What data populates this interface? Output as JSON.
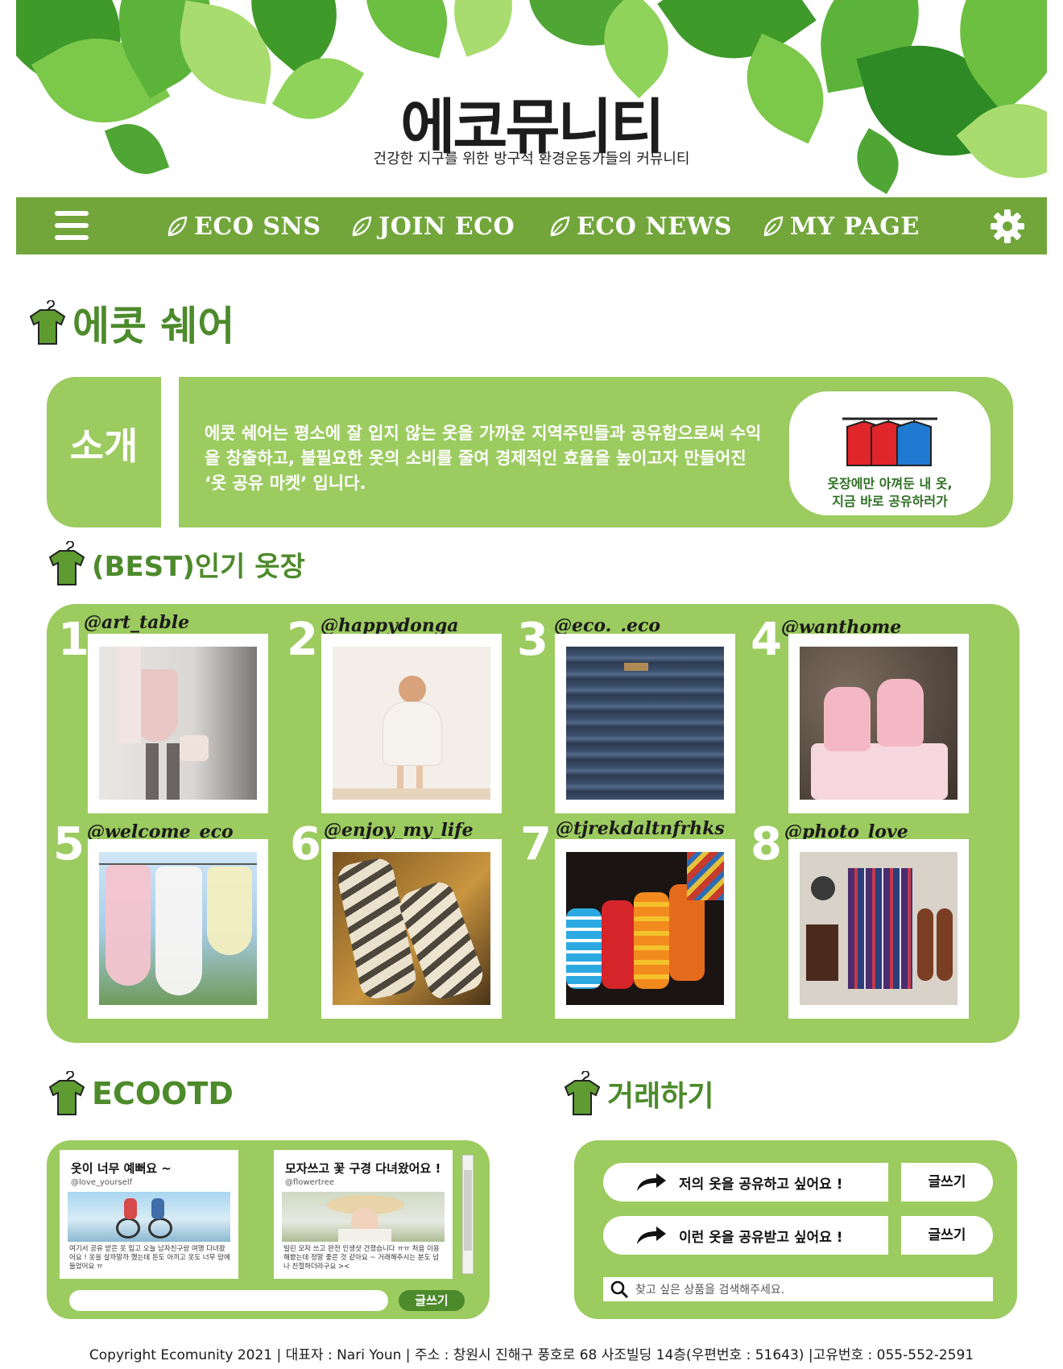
{
  "header": {
    "title": "에코뮤니티",
    "subtitle": "건강한 지구를 위한 방구석 환경운동가들의 커뮤니티"
  },
  "nav": {
    "items": [
      {
        "label": "ECO SNS"
      },
      {
        "label": "JOIN ECO"
      },
      {
        "label": "ECO NEWS"
      },
      {
        "label": "MY PAGE"
      }
    ]
  },
  "page_title": "에콧 쉐어",
  "intro": {
    "label": "소개",
    "text": "에콧 쉐어는 평소에 잘 입지 않는 옷을 가까운 지역주민들과 공유함으로써 수익을 창출하고, 불필요한 옷의 소비를 줄여 경제적인 효율을 높이고자 만들어진 ‘옷 공유 마켓’ 입니다.",
    "card_line1": "옷장에만 아껴둔 내 옷,",
    "card_line2": "지금 바로 공유하러가"
  },
  "best": {
    "heading": "(BEST)인기 옷장",
    "items": [
      {
        "rank": "1",
        "user": "@art_table"
      },
      {
        "rank": "2",
        "user": "@happydonga"
      },
      {
        "rank": "3",
        "user": "@eco._.eco"
      },
      {
        "rank": "4",
        "user": "@wanthome"
      },
      {
        "rank": "5",
        "user": "@welcome_eco"
      },
      {
        "rank": "6",
        "user": "@enjoy_my_life"
      },
      {
        "rank": "7",
        "user": "@tjrekdaltnfrhks"
      },
      {
        "rank": "8",
        "user": "@photo_love"
      }
    ]
  },
  "ootd": {
    "heading": "ECOOTD",
    "posts": [
      {
        "title": "옷이 너무 예뻐요 ~",
        "user": "@love_yourself",
        "body": "여기서 공유 받은 옷 입고 오늘 남자친구랑 여행 다녀왔어요 ! 옷을 살까말까 했는데 돈도 아끼고 옷도 너무 맘에 들었어요 ㅠ"
      },
      {
        "title": "모자쓰고 꽃 구경 다녀왔어요 !",
        "user": "@flowertree",
        "body": "빌린 모자 쓰고 완전 인생샷 건졌습니다 ㅠㅠ 처음 이용해봤는데 정말 좋은 것 같아요 ~ 거래해주시는 분도 넘나 친절하더라구요 ><"
      }
    ],
    "write_label": "글쓰기",
    "input_placeholder": ""
  },
  "trade": {
    "heading": "거래하기",
    "share_label": "저의 옷을 공유하고 싶어요 !",
    "receive_label": "이런 옷을 공유받고 싶어요 !",
    "write_label": "글쓰기",
    "search_placeholder": "찾고 싶은 상품을 검색해주세요."
  },
  "footer": {
    "text": "Copyright Ecomunity 2021 | 대표자 : Nari Youn | 주소 : 창원시 진해구 풍호로 68 사조빌딩 14층(우편번호 : 51643) |고유번호 : 055-552-2591"
  },
  "colors": {
    "brand_green": "#72a63b",
    "panel_green": "#9ccb60",
    "heading_green": "#4d8a2b"
  },
  "icons": [
    "menu-icon",
    "leaf-icon",
    "gear-icon",
    "shirt-icon",
    "closet-icon",
    "arrow-icon",
    "search-icon"
  ]
}
